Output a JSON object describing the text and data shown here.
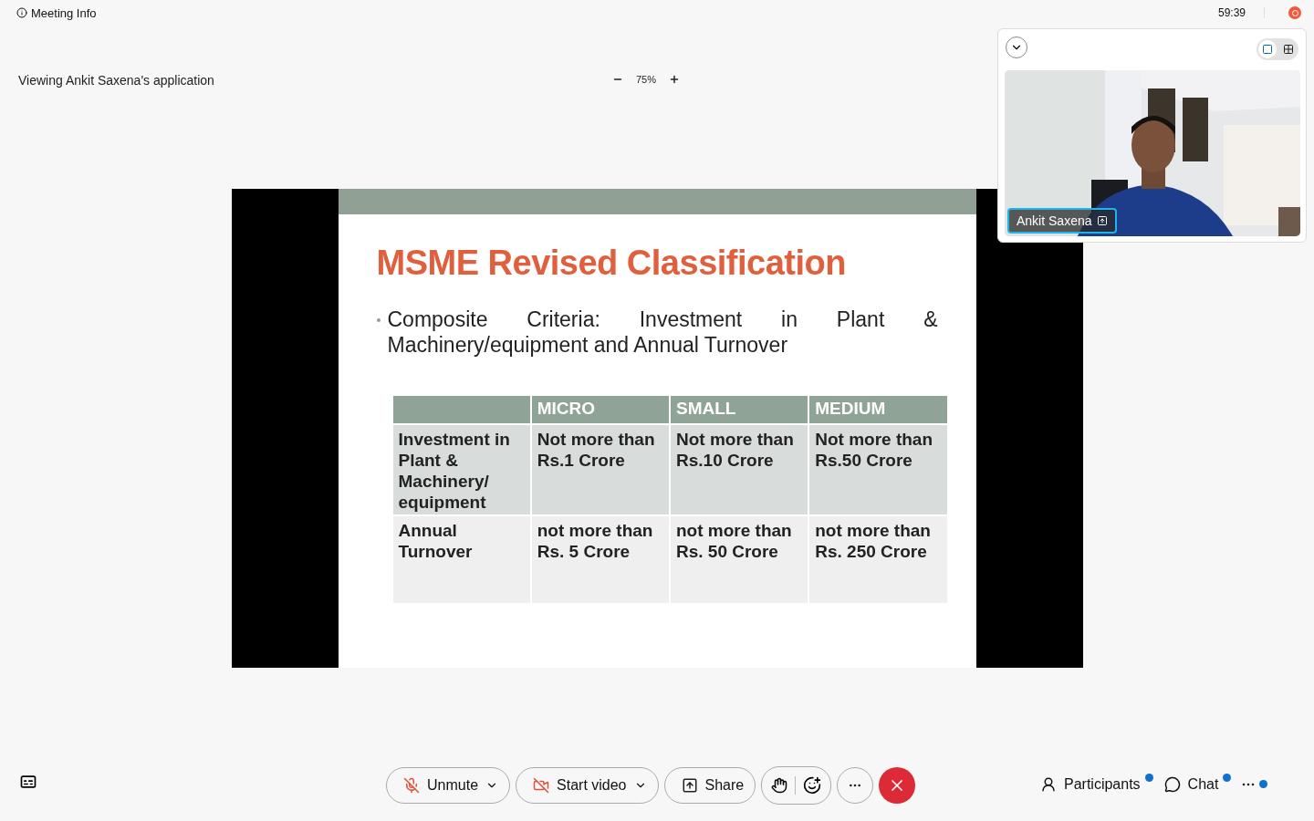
{
  "top_bar": {
    "meeting_info": "Meeting Info",
    "timer": "59:39"
  },
  "share_header": {
    "viewing": "Viewing Ankit Saxena's application",
    "zoom": "75%"
  },
  "slide": {
    "title": "MSME Revised Classification",
    "bullet": "Composite Criteria: Investment in Plant & Machinery/equipment and Annual Turnover",
    "table": {
      "columns": [
        "",
        "MICRO",
        "SMALL",
        "MEDIUM"
      ],
      "rows": [
        [
          "Investment in Plant & Machinery/ equipment",
          "Not more than Rs.1 Crore",
          "Not more than Rs.10 Crore",
          "Not more than Rs.50 Crore"
        ],
        [
          "Annual Turnover",
          "not more than Rs. 5 Crore",
          "not more than Rs. 50 Crore",
          "not more than Rs. 250 Crore"
        ]
      ]
    }
  },
  "video_panel": {
    "layouts": [
      {
        "kind": "single",
        "selected": true
      },
      {
        "kind": "grid",
        "selected": false
      }
    ],
    "participant": {
      "kind": "picture",
      "name": "Ankit Saxena"
    }
  },
  "controls": [
    {
      "kind": "mic",
      "label": "Unmute"
    },
    {
      "kind": "video",
      "label": "Start video"
    },
    {
      "kind": "share",
      "label": "Share"
    }
  ],
  "side_buttons": [
    {
      "kind": "participants",
      "label": "Participants",
      "notification": true
    },
    {
      "kind": "chat",
      "label": "Chat",
      "notification": true
    },
    {
      "kind": "more",
      "notification": true
    }
  ]
}
